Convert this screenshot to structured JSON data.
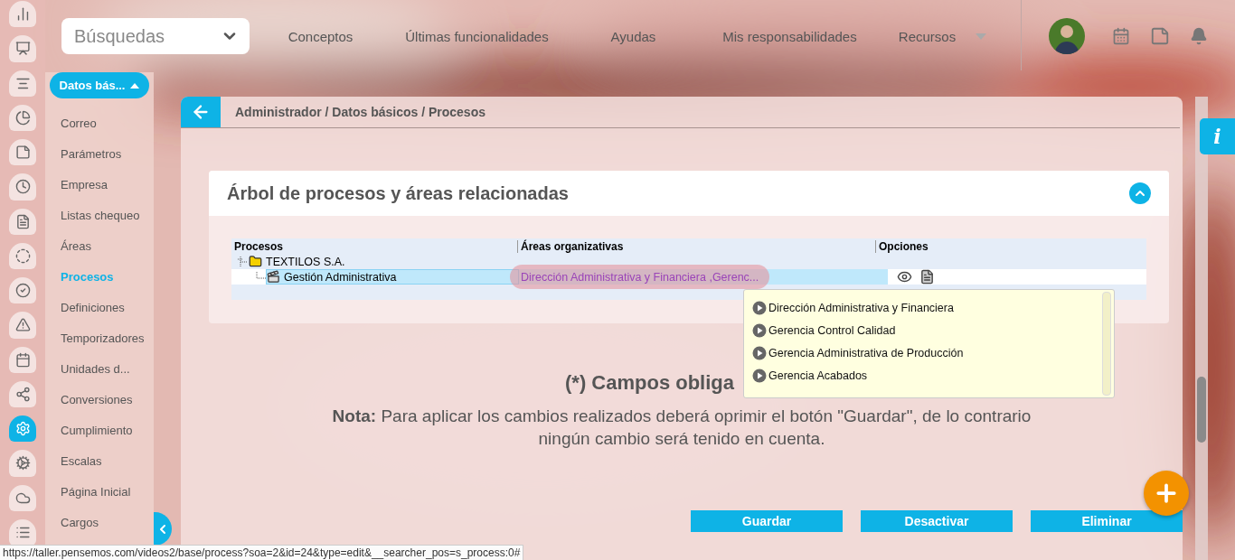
{
  "rail": [
    {
      "selected": false
    },
    {
      "selected": false
    },
    {
      "selected": false
    },
    {
      "selected": false
    },
    {
      "selected": false
    },
    {
      "selected": false
    },
    {
      "selected": false
    },
    {
      "selected": false
    },
    {
      "selected": false
    },
    {
      "selected": false
    },
    {
      "selected": false
    },
    {
      "selected": false
    },
    {
      "selected": true
    },
    {
      "selected": false
    },
    {
      "selected": false
    },
    {
      "selected": false
    }
  ],
  "section_menu": {
    "label": "Datos bás...",
    "expanded": true,
    "items": [
      {
        "label": "Correo",
        "selected": false
      },
      {
        "label": "Parámetros",
        "selected": false
      },
      {
        "label": "Empresa",
        "selected": false
      },
      {
        "label": "Listas chequeo",
        "selected": false
      },
      {
        "label": "Áreas",
        "selected": false
      },
      {
        "label": "Procesos",
        "selected": true
      },
      {
        "label": "Definiciones",
        "selected": false
      },
      {
        "label": "Temporizadores",
        "selected": false
      },
      {
        "label": "Unidades d...",
        "selected": false
      },
      {
        "label": "Conversiones",
        "selected": false
      },
      {
        "label": "Cumplimiento",
        "selected": false
      },
      {
        "label": "Escalas",
        "selected": false
      },
      {
        "label": "Página Inicial",
        "selected": false
      },
      {
        "label": "Cargos",
        "selected": false
      }
    ]
  },
  "search": {
    "placeholder": "Búsquedas"
  },
  "nav": [
    "Conceptos",
    "Últimas funcionalidades",
    "Ayudas",
    "Mis responsabilidades",
    "Recursos"
  ],
  "breadcrumb": "Administrador / Datos básicos / Procesos",
  "panel": {
    "title": "Árbol de procesos y áreas relacionadas",
    "expanded": true,
    "columns": [
      "Procesos",
      "Áreas organizativas",
      "Opciones"
    ],
    "tree": [
      {
        "label": "TEXTILOS S.A.",
        "kind": "folder",
        "expanded": true,
        "selected": false,
        "children": [
          {
            "label": "Gestión Administrativa",
            "kind": "process",
            "selected": true,
            "areas": "Dirección Administrativa y Financiera ,Gerenc..."
          }
        ]
      }
    ]
  },
  "popup": {
    "items": [
      "Dirección Administrativa y Financiera",
      "Gerencia Control Calidad",
      "Gerencia Administrativa de Producción",
      "Gerencia Acabados"
    ]
  },
  "required_note": "(*) Campos obliga",
  "note": "**Nota:** Para aplicar los cambios realizados deberá oprimir el botón \"Guardar\", de lo contrario ningún cambio será tenido en cuenta.",
  "buttons": [
    "Guardar",
    "Desactivar",
    "Eliminar"
  ],
  "info_button": "i",
  "status_url": "https://taller.pensemos.com/videos2/base/process?soa=2&id=24&type=edit&__searcher_pos=s_process:0#"
}
